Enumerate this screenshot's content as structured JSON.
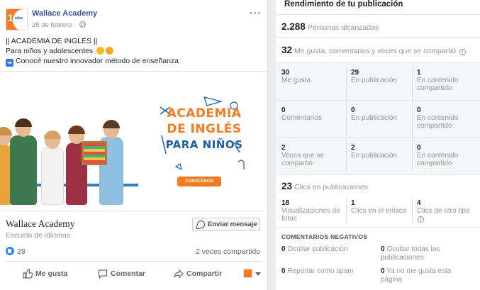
{
  "post": {
    "page_name": "Wallace Academy",
    "date": "28 de febrero",
    "avatar_text": "10",
    "avatar_sub": "años",
    "text_line1": "|| ACADEMIA DE INGLÉS ||",
    "text_line2": "Para niños y adolescentes",
    "text_line3": "Conocé nuestro innovador método de enseñanza",
    "image": {
      "brand_line1": "ACADEMIA",
      "brand_line2": "DE INGLÉS",
      "brand_line3": "PARA NIÑOS",
      "cta": "CONOCENOS"
    },
    "footer_name": "Wallace Academy",
    "category": "Escuela de idiomas",
    "send_message_label": "Enviar mensaje",
    "like_count": "28",
    "shares": "2 veces compartido",
    "actions": {
      "like": "Me gusta",
      "comment": "Comentar",
      "share": "Compartir"
    }
  },
  "insights": {
    "title": "Rendimiento de tu publicación",
    "reach_value": "2.288",
    "reach_label": "Personas alcanzadas",
    "reactions_value": "32",
    "reactions_label": "Me gusta, comentarios y veces que se compartió",
    "grid": [
      [
        {
          "num": "30",
          "label": "Me gusta"
        },
        {
          "num": "29",
          "label": "En publicación"
        },
        {
          "num": "1",
          "label": "En contenido compartido"
        }
      ],
      [
        {
          "num": "0",
          "label": "Comentarios"
        },
        {
          "num": "0",
          "label": "En publicación"
        },
        {
          "num": "0",
          "label": "En contenido compartido"
        }
      ],
      [
        {
          "num": "2",
          "label": "Veces que se compartió"
        },
        {
          "num": "2",
          "label": "En publicación"
        },
        {
          "num": "0",
          "label": "En contenido compartido"
        }
      ]
    ],
    "clicks_value": "23",
    "clicks_label": "Clics en publicaciones",
    "clicks": [
      {
        "num": "18",
        "label": "Visualizaciones de fotos"
      },
      {
        "num": "1",
        "label": "Clics en el enlace"
      },
      {
        "num": "4",
        "label": "Clics de otro tipo"
      }
    ],
    "negative_title": "COMENTARIOS NEGATIVOS",
    "negative": [
      {
        "num": "0",
        "label": "Ocultar publicación"
      },
      {
        "num": "0",
        "label": "Ocultar todas las publicaciones"
      },
      {
        "num": "0",
        "label": "Reportar como spam"
      },
      {
        "num": "0",
        "label": "Ya no me gusta esta página"
      }
    ]
  },
  "colors": {
    "link_blue": "#365899",
    "brand_orange": "#f47b20",
    "brand_blue": "#1b5fa8",
    "like_blue": "#2d88ff"
  }
}
